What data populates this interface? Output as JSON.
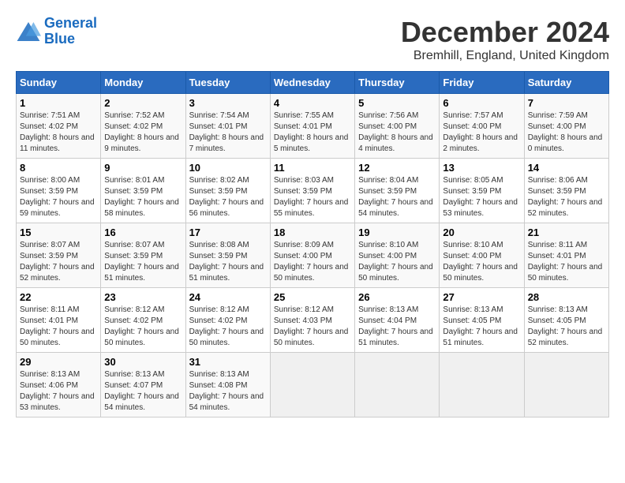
{
  "header": {
    "logo_line1": "General",
    "logo_line2": "Blue",
    "title": "December 2024",
    "subtitle": "Bremhill, England, United Kingdom"
  },
  "days_of_week": [
    "Sunday",
    "Monday",
    "Tuesday",
    "Wednesday",
    "Thursday",
    "Friday",
    "Saturday"
  ],
  "weeks": [
    [
      {
        "day": "1",
        "sunrise": "Sunrise: 7:51 AM",
        "sunset": "Sunset: 4:02 PM",
        "daylight": "Daylight: 8 hours and 11 minutes."
      },
      {
        "day": "2",
        "sunrise": "Sunrise: 7:52 AM",
        "sunset": "Sunset: 4:02 PM",
        "daylight": "Daylight: 8 hours and 9 minutes."
      },
      {
        "day": "3",
        "sunrise": "Sunrise: 7:54 AM",
        "sunset": "Sunset: 4:01 PM",
        "daylight": "Daylight: 8 hours and 7 minutes."
      },
      {
        "day": "4",
        "sunrise": "Sunrise: 7:55 AM",
        "sunset": "Sunset: 4:01 PM",
        "daylight": "Daylight: 8 hours and 5 minutes."
      },
      {
        "day": "5",
        "sunrise": "Sunrise: 7:56 AM",
        "sunset": "Sunset: 4:00 PM",
        "daylight": "Daylight: 8 hours and 4 minutes."
      },
      {
        "day": "6",
        "sunrise": "Sunrise: 7:57 AM",
        "sunset": "Sunset: 4:00 PM",
        "daylight": "Daylight: 8 hours and 2 minutes."
      },
      {
        "day": "7",
        "sunrise": "Sunrise: 7:59 AM",
        "sunset": "Sunset: 4:00 PM",
        "daylight": "Daylight: 8 hours and 0 minutes."
      }
    ],
    [
      {
        "day": "8",
        "sunrise": "Sunrise: 8:00 AM",
        "sunset": "Sunset: 3:59 PM",
        "daylight": "Daylight: 7 hours and 59 minutes."
      },
      {
        "day": "9",
        "sunrise": "Sunrise: 8:01 AM",
        "sunset": "Sunset: 3:59 PM",
        "daylight": "Daylight: 7 hours and 58 minutes."
      },
      {
        "day": "10",
        "sunrise": "Sunrise: 8:02 AM",
        "sunset": "Sunset: 3:59 PM",
        "daylight": "Daylight: 7 hours and 56 minutes."
      },
      {
        "day": "11",
        "sunrise": "Sunrise: 8:03 AM",
        "sunset": "Sunset: 3:59 PM",
        "daylight": "Daylight: 7 hours and 55 minutes."
      },
      {
        "day": "12",
        "sunrise": "Sunrise: 8:04 AM",
        "sunset": "Sunset: 3:59 PM",
        "daylight": "Daylight: 7 hours and 54 minutes."
      },
      {
        "day": "13",
        "sunrise": "Sunrise: 8:05 AM",
        "sunset": "Sunset: 3:59 PM",
        "daylight": "Daylight: 7 hours and 53 minutes."
      },
      {
        "day": "14",
        "sunrise": "Sunrise: 8:06 AM",
        "sunset": "Sunset: 3:59 PM",
        "daylight": "Daylight: 7 hours and 52 minutes."
      }
    ],
    [
      {
        "day": "15",
        "sunrise": "Sunrise: 8:07 AM",
        "sunset": "Sunset: 3:59 PM",
        "daylight": "Daylight: 7 hours and 52 minutes."
      },
      {
        "day": "16",
        "sunrise": "Sunrise: 8:07 AM",
        "sunset": "Sunset: 3:59 PM",
        "daylight": "Daylight: 7 hours and 51 minutes."
      },
      {
        "day": "17",
        "sunrise": "Sunrise: 8:08 AM",
        "sunset": "Sunset: 3:59 PM",
        "daylight": "Daylight: 7 hours and 51 minutes."
      },
      {
        "day": "18",
        "sunrise": "Sunrise: 8:09 AM",
        "sunset": "Sunset: 4:00 PM",
        "daylight": "Daylight: 7 hours and 50 minutes."
      },
      {
        "day": "19",
        "sunrise": "Sunrise: 8:10 AM",
        "sunset": "Sunset: 4:00 PM",
        "daylight": "Daylight: 7 hours and 50 minutes."
      },
      {
        "day": "20",
        "sunrise": "Sunrise: 8:10 AM",
        "sunset": "Sunset: 4:00 PM",
        "daylight": "Daylight: 7 hours and 50 minutes."
      },
      {
        "day": "21",
        "sunrise": "Sunrise: 8:11 AM",
        "sunset": "Sunset: 4:01 PM",
        "daylight": "Daylight: 7 hours and 50 minutes."
      }
    ],
    [
      {
        "day": "22",
        "sunrise": "Sunrise: 8:11 AM",
        "sunset": "Sunset: 4:01 PM",
        "daylight": "Daylight: 7 hours and 50 minutes."
      },
      {
        "day": "23",
        "sunrise": "Sunrise: 8:12 AM",
        "sunset": "Sunset: 4:02 PM",
        "daylight": "Daylight: 7 hours and 50 minutes."
      },
      {
        "day": "24",
        "sunrise": "Sunrise: 8:12 AM",
        "sunset": "Sunset: 4:02 PM",
        "daylight": "Daylight: 7 hours and 50 minutes."
      },
      {
        "day": "25",
        "sunrise": "Sunrise: 8:12 AM",
        "sunset": "Sunset: 4:03 PM",
        "daylight": "Daylight: 7 hours and 50 minutes."
      },
      {
        "day": "26",
        "sunrise": "Sunrise: 8:13 AM",
        "sunset": "Sunset: 4:04 PM",
        "daylight": "Daylight: 7 hours and 51 minutes."
      },
      {
        "day": "27",
        "sunrise": "Sunrise: 8:13 AM",
        "sunset": "Sunset: 4:05 PM",
        "daylight": "Daylight: 7 hours and 51 minutes."
      },
      {
        "day": "28",
        "sunrise": "Sunrise: 8:13 AM",
        "sunset": "Sunset: 4:05 PM",
        "daylight": "Daylight: 7 hours and 52 minutes."
      }
    ],
    [
      {
        "day": "29",
        "sunrise": "Sunrise: 8:13 AM",
        "sunset": "Sunset: 4:06 PM",
        "daylight": "Daylight: 7 hours and 53 minutes."
      },
      {
        "day": "30",
        "sunrise": "Sunrise: 8:13 AM",
        "sunset": "Sunset: 4:07 PM",
        "daylight": "Daylight: 7 hours and 54 minutes."
      },
      {
        "day": "31",
        "sunrise": "Sunrise: 8:13 AM",
        "sunset": "Sunset: 4:08 PM",
        "daylight": "Daylight: 7 hours and 54 minutes."
      },
      {
        "day": "",
        "sunrise": "",
        "sunset": "",
        "daylight": ""
      },
      {
        "day": "",
        "sunrise": "",
        "sunset": "",
        "daylight": ""
      },
      {
        "day": "",
        "sunrise": "",
        "sunset": "",
        "daylight": ""
      },
      {
        "day": "",
        "sunrise": "",
        "sunset": "",
        "daylight": ""
      }
    ]
  ]
}
